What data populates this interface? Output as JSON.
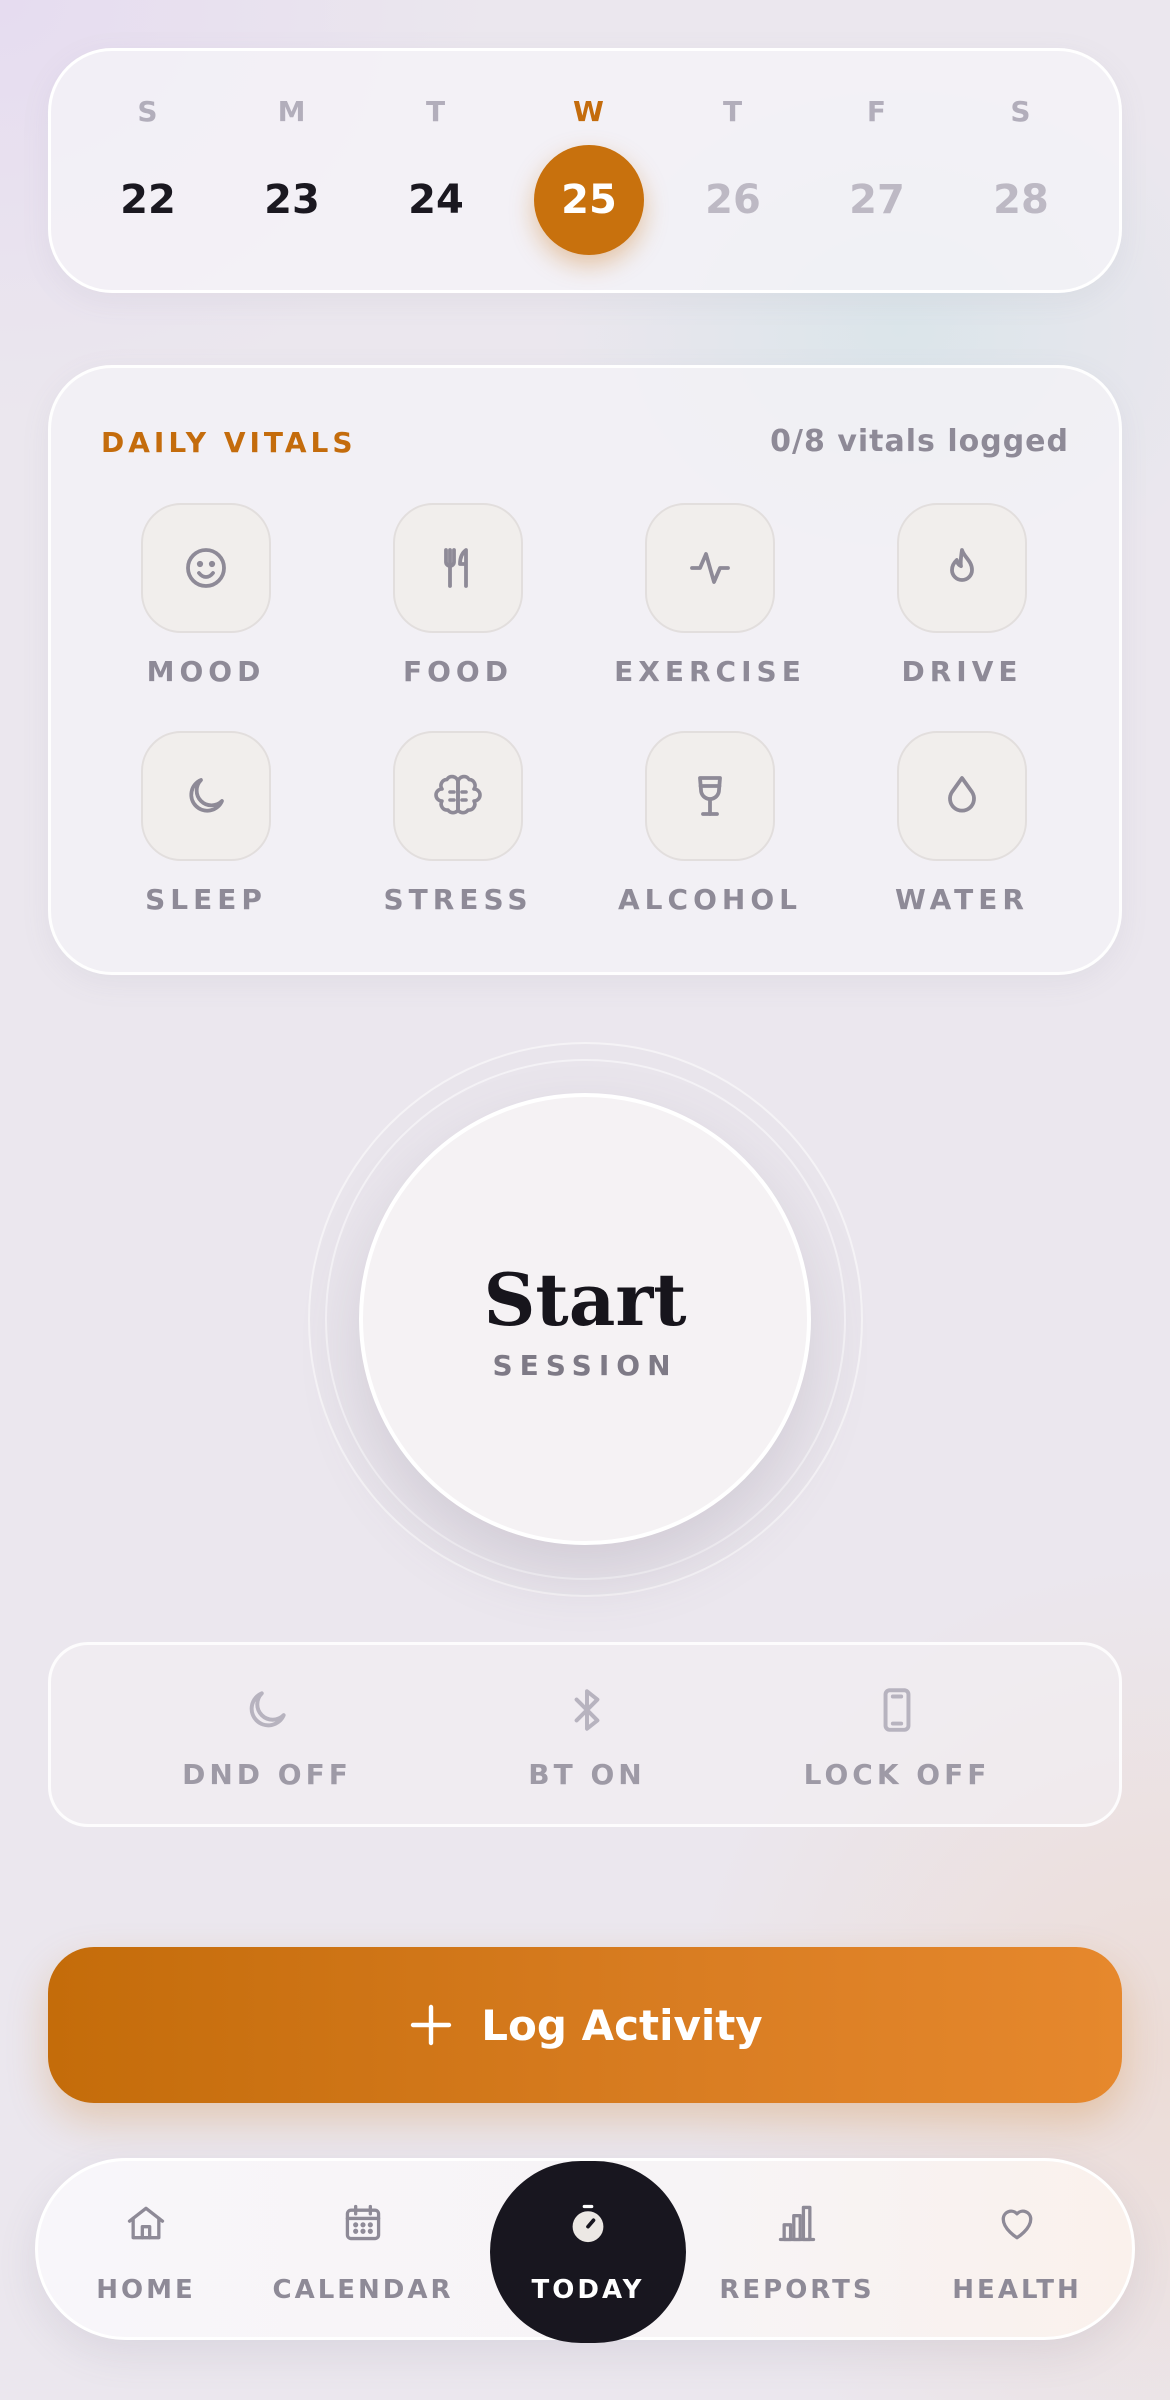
{
  "week": {
    "days": [
      {
        "dow": "S",
        "num": "22"
      },
      {
        "dow": "M",
        "num": "23"
      },
      {
        "dow": "T",
        "num": "24"
      },
      {
        "dow": "W",
        "num": "25"
      },
      {
        "dow": "T",
        "num": "26"
      },
      {
        "dow": "F",
        "num": "27"
      },
      {
        "dow": "S",
        "num": "28"
      }
    ],
    "selected": "25"
  },
  "vitals": {
    "title": "DAILY VITALS",
    "count": "0/8 vitals logged",
    "items": [
      {
        "label": "MOOD",
        "icon": "smile-icon"
      },
      {
        "label": "FOOD",
        "icon": "utensils-icon"
      },
      {
        "label": "EXERCISE",
        "icon": "activity-icon"
      },
      {
        "label": "DRIVE",
        "icon": "flame-icon"
      },
      {
        "label": "SLEEP",
        "icon": "moon-icon"
      },
      {
        "label": "STRESS",
        "icon": "brain-icon"
      },
      {
        "label": "ALCOHOL",
        "icon": "wine-glass-icon"
      },
      {
        "label": "WATER",
        "icon": "droplet-icon"
      }
    ]
  },
  "session": {
    "title": "Start",
    "subtitle": "SESSION"
  },
  "status": {
    "items": [
      {
        "label": "DND OFF",
        "icon": "moon-icon"
      },
      {
        "label": "BT ON",
        "icon": "bluetooth-icon"
      },
      {
        "label": "LOCK OFF",
        "icon": "phone-icon"
      }
    ]
  },
  "log": {
    "label": "Log Activity",
    "icon": "plus-icon"
  },
  "nav": {
    "items": [
      {
        "label": "HOME",
        "icon": "home-icon"
      },
      {
        "label": "CALENDAR",
        "icon": "calendar-icon"
      },
      {
        "label": "TODAY",
        "icon": "stopwatch-icon"
      },
      {
        "label": "REPORTS",
        "icon": "bar-chart-icon"
      },
      {
        "label": "HEALTH",
        "icon": "heart-icon"
      }
    ],
    "active": "TODAY"
  },
  "colors": {
    "accent": "#c8710d",
    "dark": "#18161f",
    "muted": "#8e8a97"
  }
}
